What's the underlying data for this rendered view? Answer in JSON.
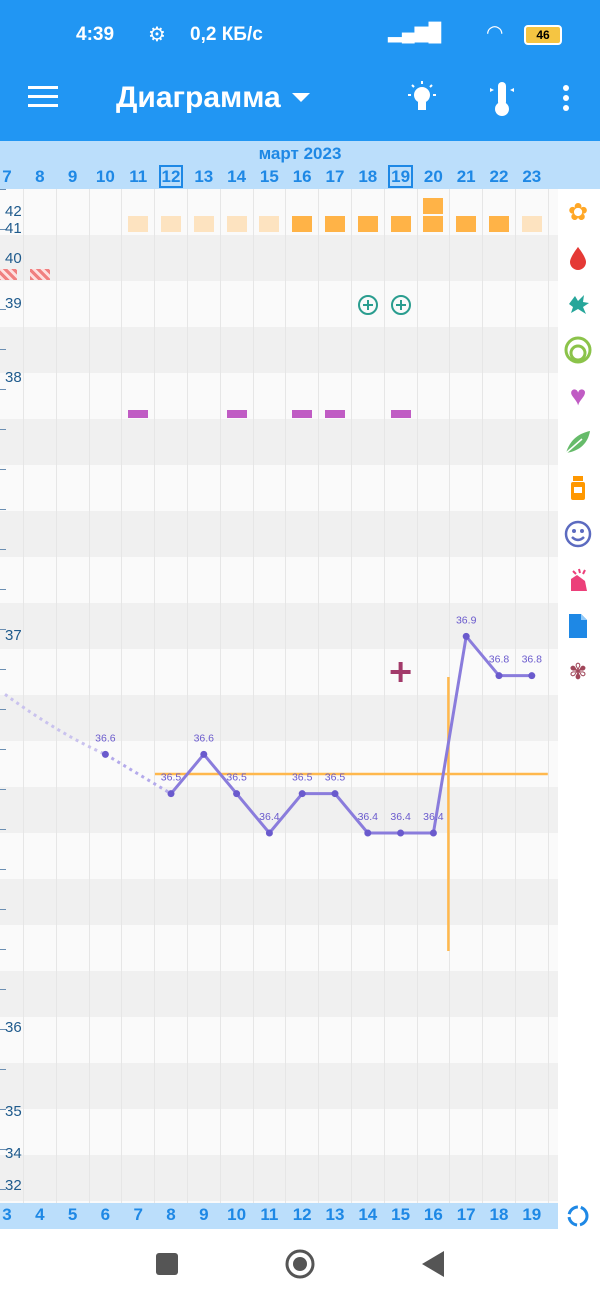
{
  "status_bar": {
    "time": "4:39",
    "speed": "0,2 КБ/с",
    "battery": "46"
  },
  "app_bar": {
    "title": "Диаграмма",
    "icons": [
      "menu-icon",
      "dropdown-arrow-icon",
      "lightbulb-icon",
      "thermometer-icon",
      "more-vert-icon"
    ]
  },
  "month_label": "март 2023",
  "top_days": [
    "7",
    "8",
    "9",
    "10",
    "11",
    "12",
    "13",
    "14",
    "15",
    "16",
    "17",
    "18",
    "19",
    "20",
    "21",
    "22",
    "23"
  ],
  "top_days_boxed": [
    "12",
    "19"
  ],
  "bottom_days": [
    "3",
    "4",
    "5",
    "6",
    "7",
    "8",
    "9",
    "10",
    "11",
    "12",
    "13",
    "14",
    "15",
    "16",
    "17",
    "18",
    "19"
  ],
  "y_axis_labels": [
    "42",
    "41",
    "40",
    "39",
    "38",
    "37",
    "36",
    "35",
    "34",
    "32"
  ],
  "side_icons": [
    "sun-flower-icon",
    "blood-drop-icon",
    "splash-icon",
    "cervix-rings-icon",
    "heart-icon",
    "leaf-icon",
    "medicine-bottle-icon",
    "smiley-icon",
    "hand-pain-icon",
    "note-document-icon",
    "flower-check-icon",
    "refresh-icon"
  ],
  "chart_data": {
    "type": "line",
    "title": "",
    "xlabel": "",
    "ylabel": "",
    "series": [
      {
        "values": [
          {
            "cycle_day": 6,
            "date": "10",
            "temp": 36.6
          },
          {
            "cycle_day": 8,
            "date": "12",
            "temp": 36.5
          },
          {
            "cycle_day": 9,
            "date": "13",
            "temp": 36.6
          },
          {
            "cycle_day": 10,
            "date": "14",
            "temp": 36.5
          },
          {
            "cycle_day": 11,
            "date": "15",
            "temp": 36.4
          },
          {
            "cycle_day": 12,
            "date": "16",
            "temp": 36.5
          },
          {
            "cycle_day": 13,
            "date": "17",
            "temp": 36.5
          },
          {
            "cycle_day": 14,
            "date": "18",
            "temp": 36.4
          },
          {
            "cycle_day": 15,
            "date": "19",
            "temp": 36.4
          },
          {
            "cycle_day": 16,
            "date": "20",
            "temp": 36.4
          },
          {
            "cycle_day": 17,
            "date": "21",
            "temp": 36.9
          },
          {
            "cycle_day": 18,
            "date": "22",
            "temp": 36.8
          },
          {
            "cycle_day": 19,
            "date": "23",
            "temp": 36.8
          }
        ]
      }
    ],
    "point_labels": [
      "36.6",
      "36.5",
      "36.6",
      "36.5",
      "36.4",
      "36.5",
      "36.5",
      "36.4",
      "36.4",
      "36.4",
      "36.9",
      "36.8",
      "36.8"
    ],
    "coverline_temp": 36.55,
    "ovulation_after_cycle_day": 16,
    "intercourse_marker_cycle_day": 15,
    "symptom_rows": {
      "sun": {
        "light_days": [
          "11",
          "12",
          "13",
          "14",
          "15",
          "23"
        ],
        "dark_days": [
          "16",
          "17",
          "18",
          "19",
          "20",
          "21",
          "22"
        ],
        "extra_top_day": "20"
      },
      "bleeding_days": [
        "7",
        "8"
      ],
      "test_plus_days": [
        "18",
        "19"
      ],
      "heart_days": [
        "11",
        "14",
        "16",
        "17",
        "19"
      ]
    },
    "colors": {
      "line": "#8a7cdc",
      "coverline": "#ffb84d",
      "sun_light": "#fde3c0",
      "sun_dark": "#ffb347",
      "heart": "#c05cc4",
      "test": "#2a9d8f",
      "plus": "#a23a6a"
    }
  }
}
